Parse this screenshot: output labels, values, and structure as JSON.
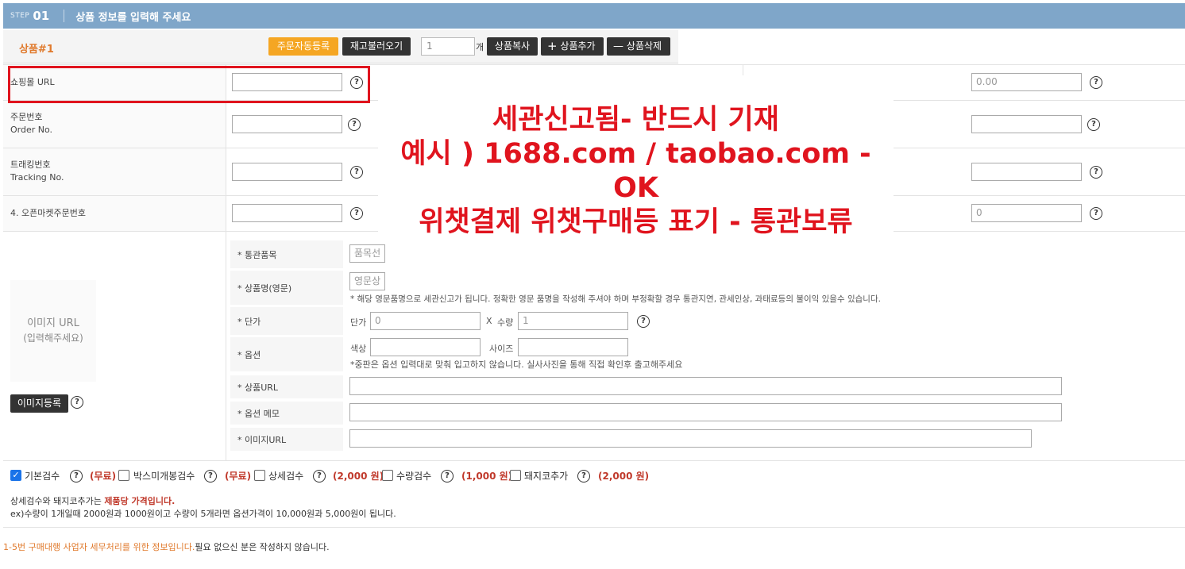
{
  "step": {
    "small": "STEP",
    "num": "01",
    "title": "상품 정보를 입력해 주세요"
  },
  "product": {
    "label": "상품#1",
    "auto_order_btn": "주문자동등록",
    "stock_reload_btn": "재고불러오기",
    "qty_value": "1",
    "qty_unit": "개",
    "copy_btn": "상품복사",
    "add_btn": "상품추가",
    "delete_btn": "상품삭제",
    "add_icon": "plus-icon",
    "delete_icon": "minus-icon"
  },
  "fields": {
    "shop_url": "쇼핑몰 URL",
    "order_no_ko": "주문번호",
    "order_no_en": "Order No.",
    "tracking_ko": "트래킹번호",
    "tracking_en": "Tracking No.",
    "openmarket": "4. 오픈마켓주문번호",
    "right_value_1": "0.00",
    "right_value_4": "0"
  },
  "overlay": {
    "line1": "세관신고됨-  반드시 기재",
    "line2": "예시 ) 1688.com / taobao.com - OK",
    "line3": "위챗결제 위챗구매등 표기 - 통관보류"
  },
  "image": {
    "placeholder_1": "이미지 URL",
    "placeholder_2": "(입력해주세요)",
    "register_btn": "이미지등록"
  },
  "detail": {
    "customs_item": "* 통관품목",
    "customs_item_placeholder": "품목선",
    "name_en": "* 상품명(영문)",
    "name_en_placeholder": "영문상",
    "name_note": "* 해당 영문품명으로 세관신고가 됩니다. 정확한 영문 품명을 작성해 주셔야 하며 부정확할 경우 통관지연, 관세인상, 과태료등의 불이익 있을수 있습니다.",
    "unit_price": "* 단가",
    "unit_price_prefix": "단가",
    "unit_price_value": "0",
    "times": "X",
    "qty_prefix": "수량",
    "qty_value": "1",
    "option": "* 옵션",
    "color": "색상",
    "size": "사이즈",
    "option_note": "*중판은 옵션 입력대로 맞춰 입고하지 않습니다. 실사사진을 통해 직접 확인후 출고해주세요",
    "product_url": "* 상품URL",
    "option_memo": "* 옵션 메모",
    "image_url": "* 이미지URL"
  },
  "inspections": [
    {
      "label": "기본검수",
      "price": "(무료)",
      "checked": true
    },
    {
      "label": "박스미개봉검수",
      "price": "(무료)",
      "checked": false
    },
    {
      "label": "상세검수",
      "price": "(2,000 원)",
      "checked": false
    },
    {
      "label": "수량검수",
      "price": "(1,000 원)",
      "checked": false
    },
    {
      "label": "돼지코추가",
      "price": "(2,000 원)",
      "checked": false
    }
  ],
  "notes": {
    "line1_a": "상세검수와 돼지코추가는 ",
    "line1_b": "제품당 가격입니다.",
    "line2": "ex)수량이 1개일때 2000원과 1000원이고 수량이 5개라면 옵션가격이 10,000원과 5,000원이 됩니다.",
    "footer_a": "1-5번 구매대행 사업자 세무처리를 위한 정보입니다.",
    "footer_b": "필요 없으신 분은 작성하지 않습니다."
  },
  "help_icon": "question-circle-icon"
}
